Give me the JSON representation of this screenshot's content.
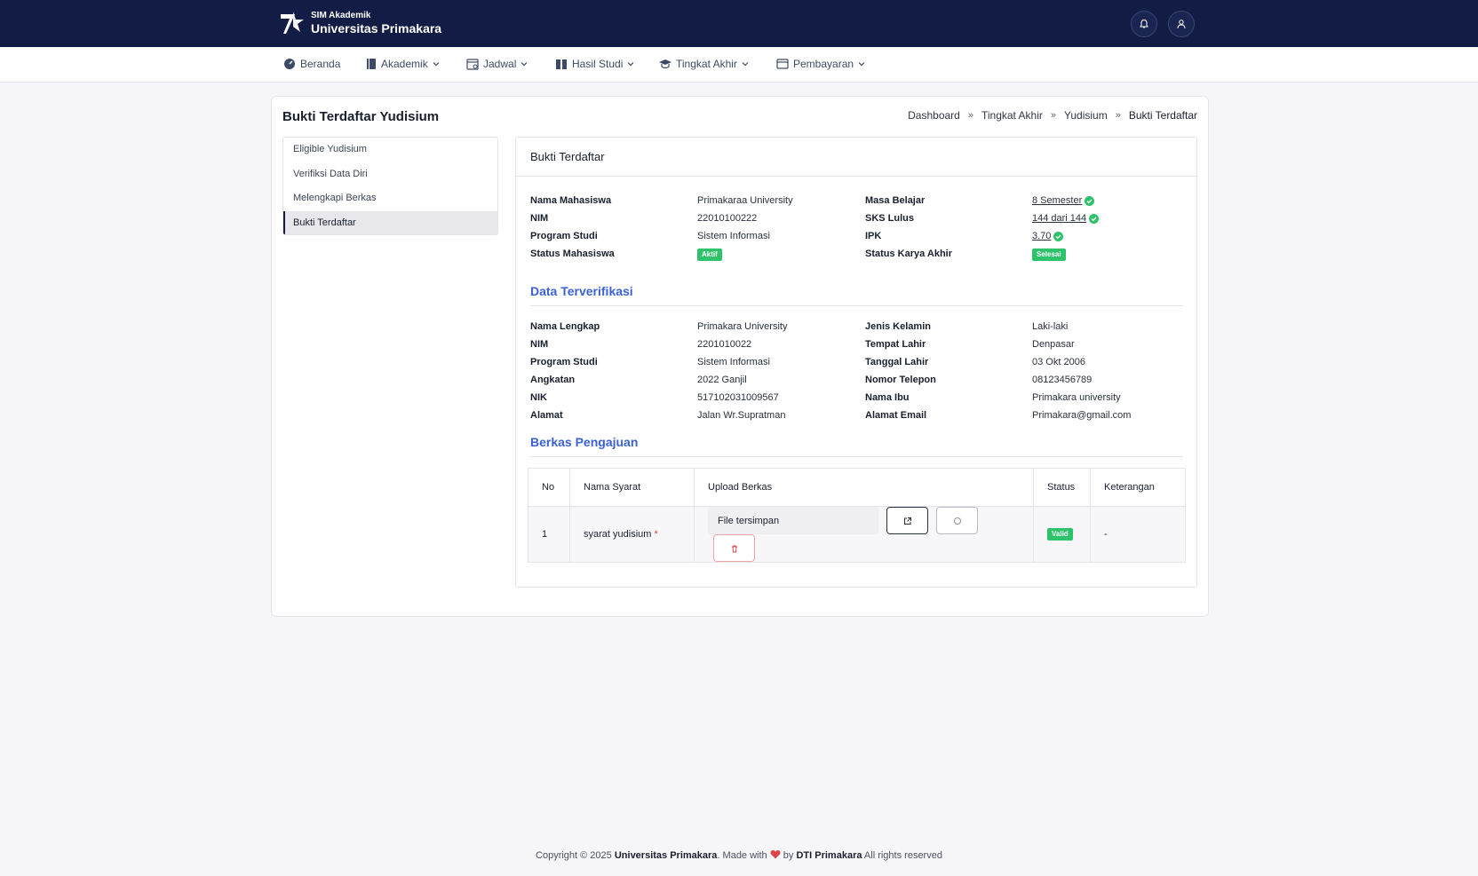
{
  "header": {
    "brand_sub": "SIM Akademik",
    "brand_title": "Universitas Primakara",
    "icons": [
      "logo-icon",
      "bell-icon",
      "user-icon"
    ]
  },
  "nav": {
    "items": [
      {
        "label": "Beranda",
        "icon": "dashboard-icon"
      },
      {
        "label": "Akademik",
        "icon": "book-icon"
      },
      {
        "label": "Jadwal",
        "icon": "calendar-icon"
      },
      {
        "label": "Hasil Studi",
        "icon": "open-book-icon"
      },
      {
        "label": "Tingkat Akhir",
        "icon": "graduation-cap-icon"
      },
      {
        "label": "Pembayaran",
        "icon": "wallet-icon"
      }
    ]
  },
  "page": {
    "title": "Bukti Terdaftar Yudisium",
    "breadcrumb": [
      "Dashboard",
      "Tingkat Akhir",
      "Yudisium",
      "Bukti Terdaftar"
    ]
  },
  "sidemenu": {
    "items": [
      {
        "label": "Eligible Yudisium"
      },
      {
        "label": "Verifiksi Data Diri"
      },
      {
        "label": "Melengkapi Berkas"
      },
      {
        "label": "Bukti Terdaftar",
        "active": true
      }
    ]
  },
  "panel": {
    "title": "Bukti Terdaftar",
    "summary": {
      "left": [
        {
          "label": "Nama Mahasiswa",
          "value": "Primakaraa University"
        },
        {
          "label": "NIM",
          "value": "22010100222"
        },
        {
          "label": "Program Studi",
          "value": "Sistem Informasi"
        },
        {
          "label": "Status Mahasiswa",
          "value": "Aktif"
        }
      ],
      "right": [
        {
          "label": "Masa Belajar",
          "value": "8 Semester"
        },
        {
          "label": "SKS Lulus",
          "value": "144 dari 144"
        },
        {
          "label": "IPK",
          "value": "3.70"
        },
        {
          "label": "Status Karya Akhir",
          "value": "Selesai"
        }
      ]
    },
    "verified": {
      "title": "Data Terverifikasi",
      "left": [
        {
          "label": "Nama Lengkap",
          "value": "Primakara University"
        },
        {
          "label": "NIM",
          "value": "2201010022"
        },
        {
          "label": "Program Studi",
          "value": "Sistem Informasi"
        },
        {
          "label": "Angkatan",
          "value": "2022 Ganjil"
        },
        {
          "label": "NIK",
          "value": "517102031009567"
        },
        {
          "label": "Alamat",
          "value": "Jalan Wr.Supratman"
        }
      ],
      "right": [
        {
          "label": "Jenis Kelamin",
          "value": "Laki-laki"
        },
        {
          "label": "Tempat Lahir",
          "value": "Denpasar"
        },
        {
          "label": "Tanggal Lahir",
          "value": "03 Okt 2006"
        },
        {
          "label": "Nomor Telepon",
          "value": "08123456789"
        },
        {
          "label": "Nama Ibu",
          "value": "Primakara university"
        },
        {
          "label": "Alamat Email",
          "value": "Primakara@gmail.com"
        }
      ]
    },
    "files": {
      "title": "Berkas Pengajuan",
      "columns": [
        "No",
        "Nama Syarat",
        "Upload Berkas",
        "Status",
        "Keterangan"
      ],
      "rows": [
        {
          "no": "1",
          "name": "syarat yudisium",
          "required_mark": "*",
          "file": "File tersimpan",
          "status": "Valid",
          "note": "-"
        }
      ]
    }
  },
  "footer": {
    "prefix": "Copyright © 2025",
    "org": "Universitas Primakara",
    "made": ". Made with",
    "by": "by",
    "team": "DTI Primakara",
    "suffix": "All rights reserved"
  },
  "colors": {
    "header_bg": "#121c45",
    "accent_blue": "#3b62d6",
    "success": "#2ec26b",
    "danger": "#e0454a"
  }
}
